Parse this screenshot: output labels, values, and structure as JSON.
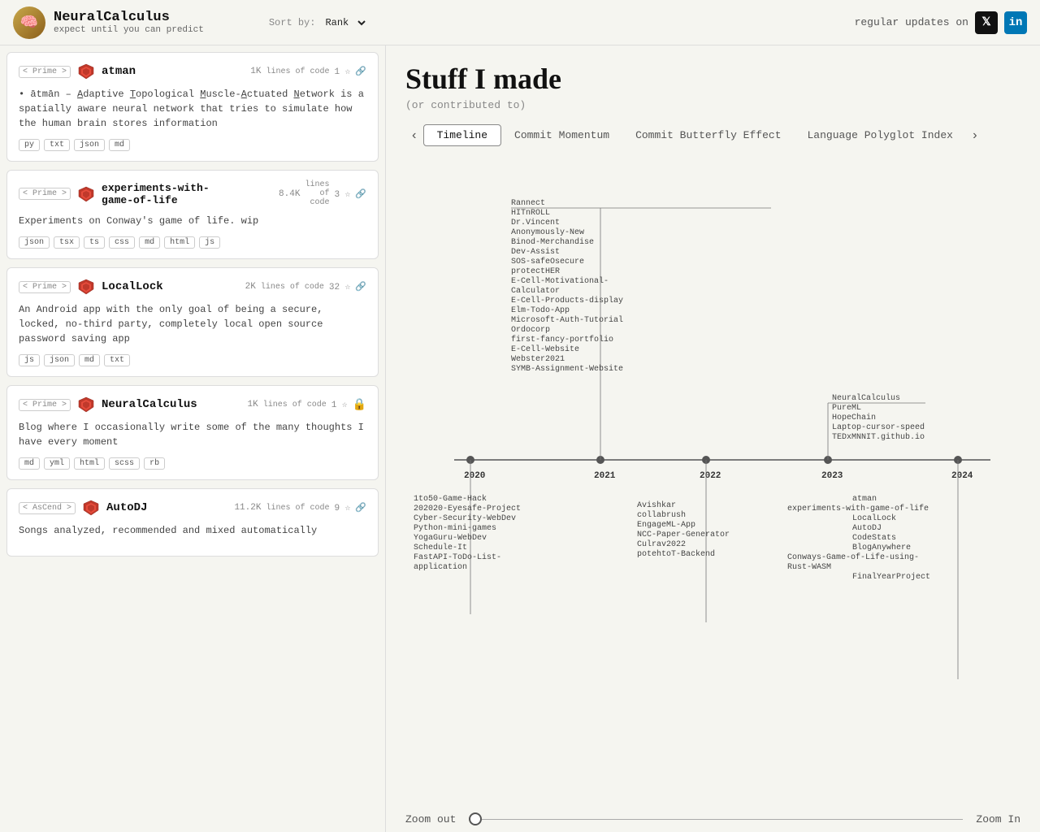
{
  "topbar": {
    "logo_title": "NeuralCalculus",
    "logo_sub": "expect until you can predict",
    "logo_emoji": "🧠",
    "sortby_label": "Sort by:",
    "sortby_value": "Rank",
    "updates_text": "regular updates on",
    "x_label": "𝕏",
    "li_label": "in"
  },
  "page": {
    "title": "Stuff I made",
    "subtitle": "(or contributed to)"
  },
  "tabs": [
    {
      "id": "timeline",
      "label": "Timeline",
      "active": true
    },
    {
      "id": "commit-momentum",
      "label": "Commit Momentum",
      "active": false
    },
    {
      "id": "commit-butterfly",
      "label": "Commit Butterfly Effect",
      "active": false
    },
    {
      "id": "language-polyglot",
      "label": "Language Polyglot Index",
      "active": false
    }
  ],
  "cards": [
    {
      "badge": "< Prime >",
      "title": "atman",
      "lines": "1K",
      "lines_label": "lines of code",
      "stars": "1",
      "desc": "• ātmān – Adaptive Topological Muscle-Actuated Network is a spatially aware neural network that tries to simulate how the human brain stores information",
      "tags": [
        "py",
        "txt",
        "json",
        "md"
      ],
      "has_lock": false
    },
    {
      "badge": "< Prime >",
      "title": "experiments-with-game-of-life",
      "lines": "8.4K",
      "lines_label": "lines of code",
      "stars": "3",
      "desc": "Experiments on Conway's game of life. wip",
      "tags": [
        "json",
        "tsx",
        "ts",
        "css",
        "md",
        "html",
        "js"
      ],
      "has_lock": false
    },
    {
      "badge": "< Prime >",
      "title": "LocalLock",
      "lines": "2K",
      "lines_label": "lines of code",
      "stars": "32",
      "desc": "An Android app with the only goal of being a secure, locked, no-third party, completely local open source password saving app",
      "tags": [
        "js",
        "json",
        "md",
        "txt"
      ],
      "has_lock": false
    },
    {
      "badge": "< Prime >",
      "title": "NeuralCalculus",
      "lines": "1K",
      "lines_label": "lines of code",
      "stars": "1",
      "desc": "Blog where I occasionally write some of the many thoughts I have every moment",
      "tags": [
        "md",
        "yml",
        "html",
        "scss",
        "rb"
      ],
      "has_lock": true
    },
    {
      "badge": "< AsCend >",
      "title": "AutoDJ",
      "lines": "11.2K",
      "lines_label": "lines of code",
      "stars": "9",
      "desc": "Songs analyzed, recommended and mixed automatically",
      "tags": [],
      "has_lock": false
    }
  ],
  "timeline": {
    "years": [
      "2020",
      "2021",
      "2022",
      "2023",
      "2024"
    ],
    "projects_2020_above": [],
    "projects_2021_above": [
      "Rannect",
      "HITnROLL",
      "Dr.Vincent",
      "Anonymously-New",
      "Binod-Merchandise",
      "Dev-Assist",
      "SOS-safeOsecure",
      "protectHER",
      "E-Cell-Motivational-Calculator",
      "E-Cell-Products-display",
      "Elm-Todo-App",
      "Microsoft-Auth-Tutorial",
      "Ordocorp",
      "first-fancy-portfolio",
      "E-Cell-Website",
      "Webster2021",
      "SYMB-Assignment-Website"
    ],
    "projects_2023_above": [
      "NeuralCalculus",
      "PureML",
      "HopeChain",
      "Laptop-cursor-speed",
      "TEDxMNNIT.github.io"
    ],
    "projects_2020_below": [
      "1to50-Game-Hack",
      "202020-Eyesafe-Project",
      "Cyber-Security-WebDev",
      "Python-mini-games",
      "YogaGuru-WebDev",
      "Schedule-It",
      "FastAPI-ToDo-List-application"
    ],
    "projects_2022_below": [
      "Avishkar",
      "collabrush",
      "EngageML-App",
      "NCC-Paper-Generator",
      "Culrav2022",
      "potehtoT-Backend"
    ],
    "projects_2024_below": [
      "atman",
      "experiments-with-game-of-life",
      "LocalLock",
      "AutoDJ",
      "CodeStats",
      "BlogAnywhere",
      "Conways-Game-of-Life-using-Rust-WASM",
      "FinalYearProject"
    ]
  },
  "zoom": {
    "out_label": "Zoom out",
    "in_label": "Zoom In"
  }
}
